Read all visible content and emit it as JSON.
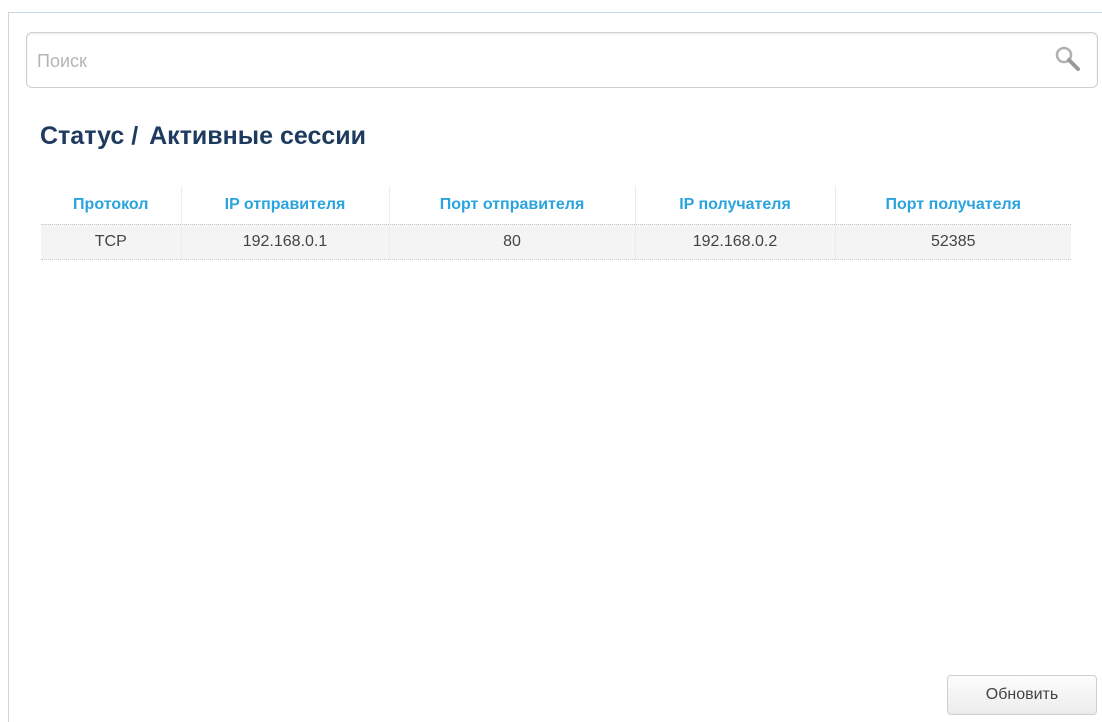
{
  "search": {
    "placeholder": "Поиск",
    "value": "",
    "icon": "search-icon"
  },
  "breadcrumb": {
    "section": "Статус",
    "separator": "/",
    "page": "Активные сессии"
  },
  "table": {
    "columns": [
      "Протокол",
      "IP отправителя",
      "Порт отправителя",
      "IP получателя",
      "Порт получателя"
    ],
    "rows": [
      [
        "TCP",
        "192.168.0.1",
        "80",
        "192.168.0.2",
        "52385"
      ]
    ]
  },
  "actions": {
    "refresh_label": "Обновить"
  },
  "colors": {
    "title": "#1e3a5f",
    "column_header": "#2aa4de",
    "row_background": "#f4f4f4"
  }
}
